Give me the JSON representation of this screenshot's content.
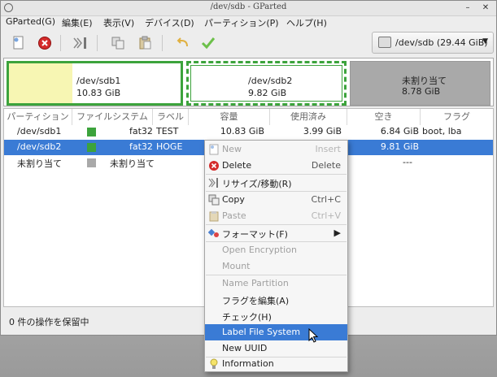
{
  "window": {
    "title": "/dev/sdb - GParted"
  },
  "menu": [
    "GParted(G)",
    "編集(E)",
    "表示(V)",
    "デバイス(D)",
    "パーティション(P)",
    "ヘルプ(H)"
  ],
  "device": {
    "label": "/dev/sdb (29.44 GiB)"
  },
  "diskmap": [
    {
      "name": "/dev/sdb1",
      "size": "10.83 GiB"
    },
    {
      "name": "/dev/sdb2",
      "size": "9.82 GiB"
    },
    {
      "name": "未割り当て",
      "size": "8.78 GiB"
    }
  ],
  "columns": [
    "パーティション",
    "ファイルシステム",
    "ラベル",
    "容量",
    "使用済み",
    "空き",
    "フラグ"
  ],
  "rows": [
    {
      "partition": "/dev/sdb1",
      "fs": "fat32",
      "label": "TEST",
      "size": "10.83 GiB",
      "used": "3.99 GiB",
      "free": "6.84 GiB",
      "flags": "boot, lba",
      "color": "#3ca33c"
    },
    {
      "partition": "/dev/sdb2",
      "fs": "fat32",
      "label": "HOGE",
      "size": "",
      "used": "",
      "free": "9.81 GiB",
      "flags": "",
      "color": "#3ca33c"
    },
    {
      "partition": "未割り当て",
      "fs": "未割り当て",
      "label": "",
      "size": "",
      "used": "",
      "free": "---",
      "flags": "",
      "color": "#a9a9a9"
    }
  ],
  "status": "0 件の操作を保留中",
  "context_menu": {
    "new": {
      "label": "New",
      "accel": "Insert"
    },
    "delete": {
      "label": "Delete",
      "accel": "Delete"
    },
    "resize": {
      "label": "リサイズ/移動(R)"
    },
    "copy": {
      "label": "Copy",
      "accel": "Ctrl+C"
    },
    "paste": {
      "label": "Paste",
      "accel": "Ctrl+V"
    },
    "format": {
      "label": "フォーマット(F)"
    },
    "open_encryption": {
      "label": "Open Encryption"
    },
    "mount": {
      "label": "Mount"
    },
    "name_partition": {
      "label": "Name Partition"
    },
    "edit_flags": {
      "label": "フラグを編集(A)"
    },
    "check": {
      "label": "チェック(H)"
    },
    "label_fs": {
      "label": "Label File System"
    },
    "new_uuid": {
      "label": "New UUID"
    },
    "information": {
      "label": "Information"
    }
  },
  "colors": {
    "selection": "#3a7bd5",
    "fat32": "#3ca33c",
    "unallocated": "#a9a9a9",
    "sdb1_fill": "#f7f6b3"
  }
}
